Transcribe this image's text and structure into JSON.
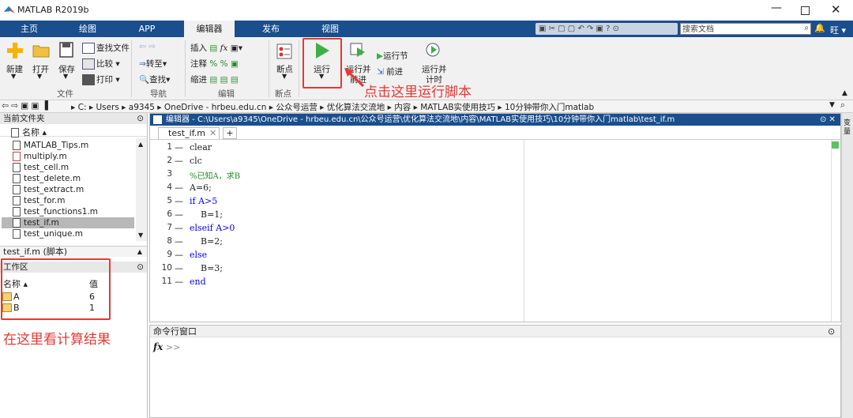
{
  "window": {
    "title": "MATLAB R2019b",
    "user": "旺"
  },
  "tabs": [
    "主页",
    "绘图",
    "APP",
    "编辑器",
    "发布",
    "视图"
  ],
  "search": {
    "placeholder": "搜索文档"
  },
  "ribbon": {
    "file": {
      "new": "新建",
      "open": "打开",
      "save": "保存",
      "find_files": "查找文件",
      "compare": "比较",
      "print": "打印",
      "group": "文件"
    },
    "nav": {
      "goto": "转至",
      "find": "查找",
      "group": "导航"
    },
    "edit": {
      "insert": "插入",
      "comment": "注释",
      "indent": "缩进",
      "group": "编辑"
    },
    "breakpoints": {
      "label": "断点",
      "group": "断点"
    },
    "run": {
      "run": "运行",
      "run_advance_1": "运行并",
      "run_advance_2": "前进",
      "run_section": "运行节",
      "advance": "前进",
      "run_time_1": "运行并",
      "run_time_2": "计时"
    }
  },
  "path": [
    "C:",
    "Users",
    "a9345",
    "OneDrive - hrbeu.edu.cn",
    "公众号运营",
    "优化算法交流地",
    "内容",
    "MATLAB实使用技巧",
    "10分钟带你入门matlab"
  ],
  "current_folder": {
    "header": "当前文件夹",
    "col_name": "名称",
    "files": [
      "MATLAB_Tips.m",
      "multiply.m",
      "test_cell.m",
      "test_delete.m",
      "test_extract.m",
      "test_for.m",
      "test_functions1.m",
      "test_if.m",
      "test_unique.m"
    ],
    "selected": "test_if.m",
    "details": "test_if.m (脚本)"
  },
  "workspace": {
    "header": "工作区",
    "col_name": "名称",
    "col_value": "值",
    "vars": [
      {
        "name": "A",
        "value": "6"
      },
      {
        "name": "B",
        "value": "1"
      }
    ]
  },
  "editor": {
    "title": "编辑器 - C:\\Users\\a9345\\OneDrive - hrbeu.edu.cn\\公众号运营\\优化算法交流地\\内容\\MATLAB实使用技巧\\10分钟带你入门matlab\\test_if.m",
    "tab": "test_if.m",
    "lines": [
      "clear",
      "clc",
      "%已知A，求B",
      "A=6;",
      "if A>5",
      "    B=1;",
      "elseif A>0",
      "    B=2;",
      "else",
      "    B=3;",
      "end"
    ],
    "line_numbers": [
      "1",
      "2",
      "3",
      "4",
      "5",
      "6",
      "7",
      "8",
      "9",
      "10",
      "11"
    ]
  },
  "command_window": {
    "header": "命令行窗口",
    "prompt": ">>",
    "fx": "fx"
  },
  "side_tab": "变量",
  "annotations": {
    "run_hint": "点击这里运行脚本",
    "workspace_hint": "在这里看计算结果"
  }
}
